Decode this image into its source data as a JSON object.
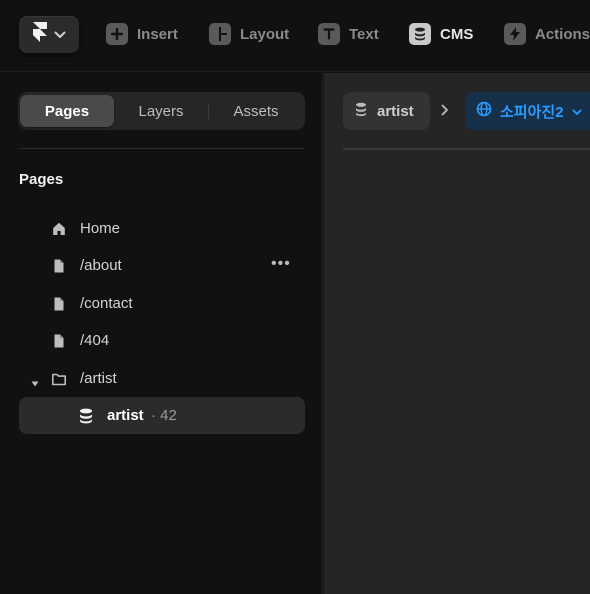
{
  "toolbar": {
    "menu_icon": "framer-logo-icon",
    "tools": [
      {
        "label": "Insert",
        "icon": "plus-icon"
      },
      {
        "label": "Layout",
        "icon": "layout-icon"
      },
      {
        "label": "Text",
        "icon": "text-icon"
      },
      {
        "label": "CMS",
        "icon": "database-icon",
        "active": true
      },
      {
        "label": "Actions",
        "icon": "bolt-icon"
      }
    ]
  },
  "sidebar": {
    "tabs": [
      {
        "label": "Pages",
        "active": true
      },
      {
        "label": "Layers"
      },
      {
        "label": "Assets"
      }
    ],
    "section_title": "Pages",
    "items": [
      {
        "label": "Home",
        "icon": "home-icon"
      },
      {
        "label": "/about",
        "icon": "page-icon",
        "more": "•••"
      },
      {
        "label": "/contact",
        "icon": "page-icon"
      },
      {
        "label": "/404",
        "icon": "page-icon"
      },
      {
        "label": "/artist",
        "icon": "folder-icon",
        "expanded": true
      },
      {
        "label": "artist",
        "count": "· 42",
        "icon": "database-icon",
        "selected": true
      }
    ]
  },
  "canvas": {
    "breadcrumb": {
      "collection": "artist",
      "locale": "소피아진2"
    }
  },
  "colors": {
    "background": "#111111",
    "canvas": "#252525",
    "accent": "#2e9bff"
  }
}
